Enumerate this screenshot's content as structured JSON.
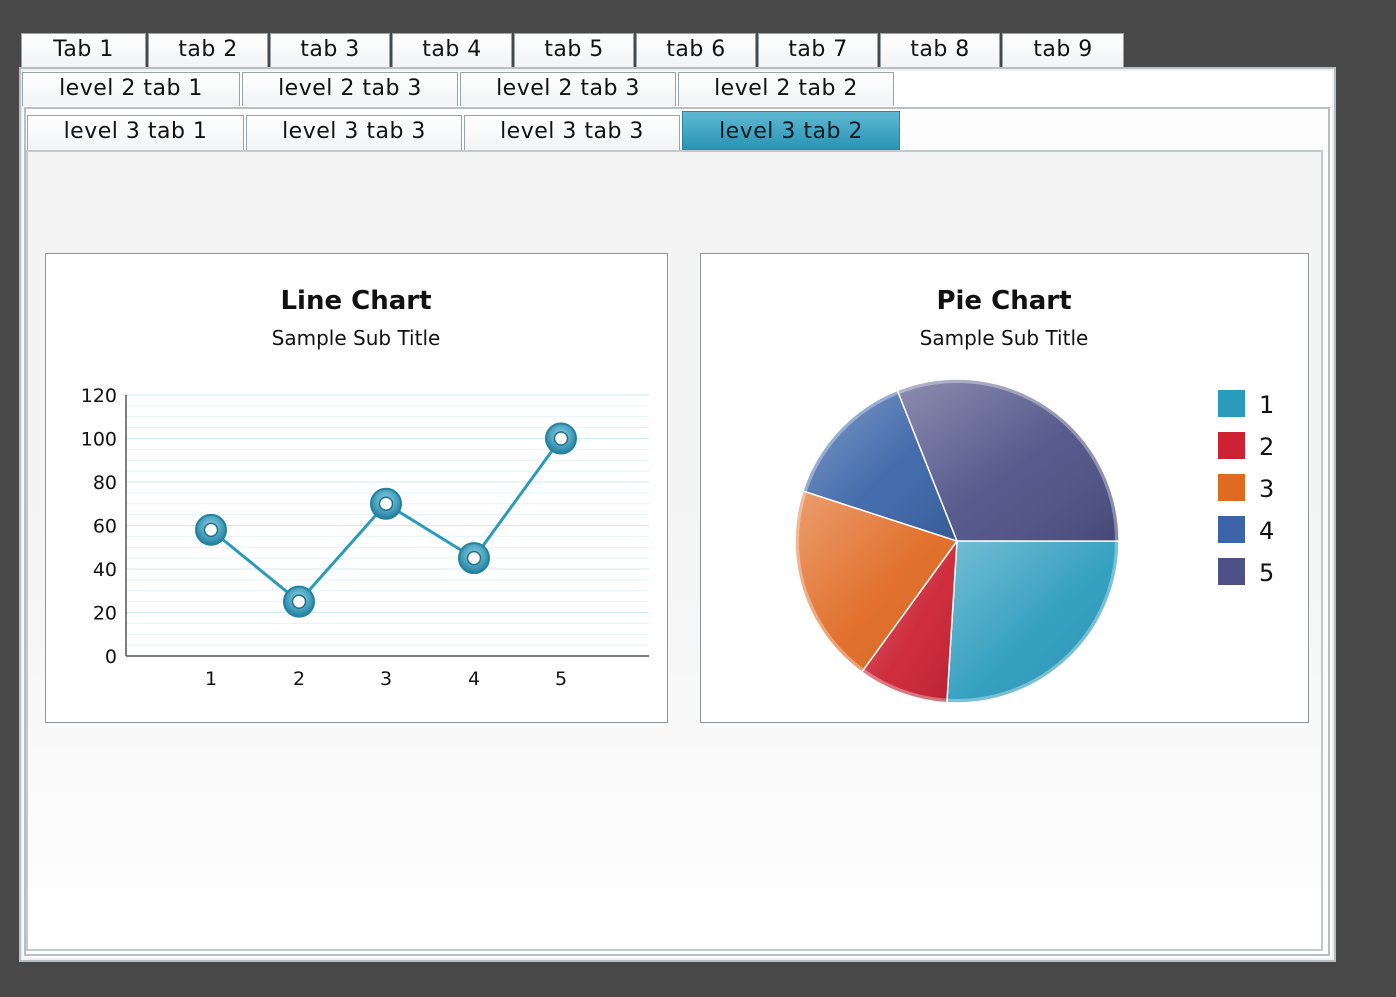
{
  "tabs_level1": [
    {
      "label": "Tab 1",
      "active": true
    },
    {
      "label": "tab 2",
      "active": false
    },
    {
      "label": "tab 3",
      "active": false
    },
    {
      "label": "tab 4",
      "active": false
    },
    {
      "label": "tab 5",
      "active": false
    },
    {
      "label": "tab 6",
      "active": false
    },
    {
      "label": "tab 7",
      "active": false
    },
    {
      "label": "tab 8",
      "active": false
    },
    {
      "label": "tab 9",
      "active": false
    }
  ],
  "tabs_level2": [
    {
      "label": "level 2 tab 1",
      "active": true
    },
    {
      "label": "level 2 tab 3",
      "active": false
    },
    {
      "label": "level 2 tab 3",
      "active": false
    },
    {
      "label": "level 2 tab 2",
      "active": false
    }
  ],
  "tabs_level3": [
    {
      "label": "level 3 tab 1",
      "active": false
    },
    {
      "label": "level 3 tab 3",
      "active": false
    },
    {
      "label": "level 3 tab 3",
      "active": false
    },
    {
      "label": "level 3 tab 2",
      "active": true
    }
  ],
  "colors": {
    "accent": "#2a9bbd",
    "pie": [
      "#2a9bbd",
      "#cc2233",
      "#e06a22",
      "#3b65a8",
      "#4e5186"
    ]
  },
  "chart_data": [
    {
      "type": "line",
      "title": "Line Chart",
      "subtitle": "Sample Sub Title",
      "categories": [
        "1",
        "2",
        "3",
        "4",
        "5"
      ],
      "values": [
        58,
        25,
        70,
        45,
        100
      ],
      "ylim": [
        0,
        120
      ],
      "yticks": [
        0,
        20,
        40,
        60,
        80,
        100,
        120
      ],
      "grid": true
    },
    {
      "type": "pie",
      "title": "Pie Chart",
      "subtitle": "Sample Sub Title",
      "labels": [
        "1",
        "2",
        "3",
        "4",
        "5"
      ],
      "values": [
        26,
        9,
        20,
        14,
        31
      ],
      "legend": "right"
    }
  ]
}
